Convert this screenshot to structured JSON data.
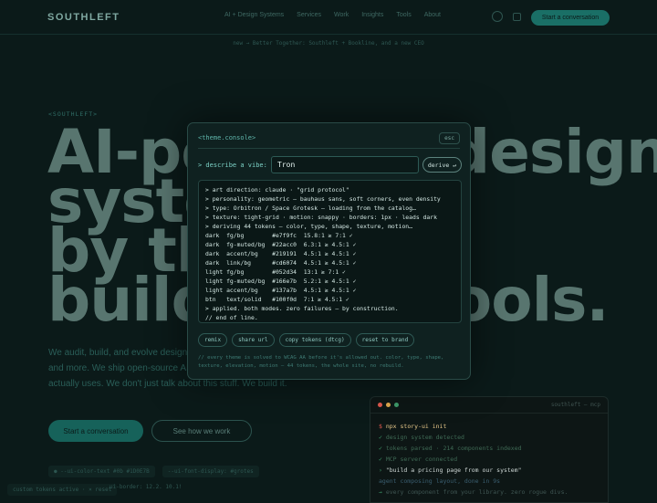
{
  "nav": {
    "logo": "SOUTHLEFT",
    "links": [
      "AI + Design Systems",
      "Services",
      "Work",
      "Insights",
      "Tools",
      "About"
    ],
    "cta": "Start a conversation"
  },
  "breadcrumb": "new → Better Together: Southleft + Bookline, and a new CEO",
  "hero": {
    "kicker": "<SOUTHLEFT>",
    "headline_lines": [
      "AI-powered design",
      "systems",
      "by the",
      "builders of tools."
    ],
    "subtext": "We audit, build, and evolve design systems for Caterpillar, Novartis, UPS, and more. We ship open-source AI tooling the design systems community actually uses. We don't just talk about this stuff. We build it.",
    "primary_button": "Start a conversation",
    "secondary_button": "See how we work",
    "chips": [
      "● --ui-color-text #0b  #1D0E7B",
      "--ui-font-display: #grotes"
    ],
    "bottom_note": "custom tokens active · × reset",
    "bottom_note2": "ui-border: 12.2. 10.1!"
  },
  "terminal": {
    "title": "southleft — mcp",
    "lines": [
      {
        "prefix": "$",
        "text": "npx story-ui init"
      },
      {
        "prefix": "✓",
        "text": "design system detected"
      },
      {
        "prefix": "✓",
        "text": "tokens parsed · 214 components indexed"
      },
      {
        "prefix": "✓",
        "text": "MCP server connected"
      },
      {
        "prefix": "›",
        "text": "\"build a pricing page from our system\""
      },
      {
        "prefix": "",
        "text": "agent  composing layout, done in 9s"
      },
      {
        "prefix": "→",
        "text": "every component from your library. zero rogue divs."
      }
    ]
  },
  "console": {
    "title": "<theme.console>",
    "esc_label": "esc",
    "vibe_label": "> describe a vibe:",
    "vibe_value": "Tron",
    "derive_label": "derive ↵",
    "log_lines": [
      "> art direction: claude · \"grid protocol\"",
      "> personality: geometric — bauhaus sans, soft corners, even density",
      "> type: Orbitron / Space Grotesk — loading from the catalog…",
      "> texture: tight-grid · motion: snappy · borders: 1px · leads dark",
      "> deriving 44 tokens — color, type, shape, texture, motion…",
      "dark  fg/bg        #e7f9fc  15.8:1 ≥ 7:1 ✓",
      "dark  fg-muted/bg  #22acc0  6.3:1 ≥ 4.5:1 ✓",
      "dark  accent/bg    #219191  4.5:1 ≥ 4.5:1 ✓",
      "dark  link/bg      #cd6074  4.5:1 ≥ 4.5:1 ✓",
      "light fg/bg        #052d34  13:1 ≥ 7:1 ✓",
      "light fg-muted/bg  #166e7b  5.2:1 ≥ 4.5:1 ✓",
      "light accent/bg    #137a7b  4.5:1 ≥ 4.5:1 ✓",
      "btn   text/solid   #100f0d  7:1 ≥ 4.5:1 ✓",
      "> applied. both modes. zero failures — by construction.",
      "// end of line."
    ],
    "actions": [
      "remix",
      "share url",
      "copy tokens (dtcg)",
      "reset to brand"
    ],
    "footnote": "// every theme is solved to WCAG AA before it's allowed out. color, type, shape, texture, elevation, motion — 44 tokens, the whole site, no rebuild."
  },
  "colors": {
    "background": "#0b1a19",
    "accent": "#1a6f66",
    "console_text": "#d3e7e3",
    "terminal_red": "#e0594e",
    "terminal_yellow": "#e0a84e",
    "terminal_green": "#3e9a6a"
  }
}
